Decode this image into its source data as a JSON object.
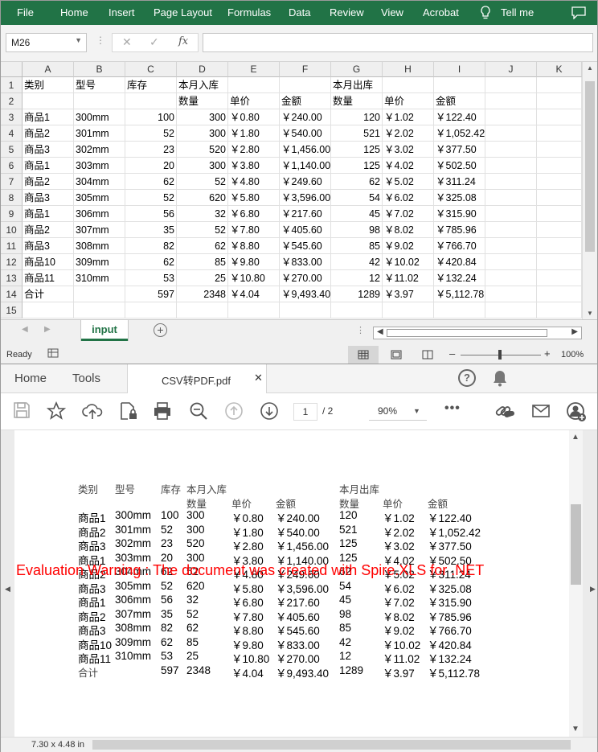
{
  "excel": {
    "ribbon_tabs": [
      "File",
      "Home",
      "Insert",
      "Page Layout",
      "Formulas",
      "Data",
      "Review",
      "View",
      "Acrobat"
    ],
    "tell_me": "Tell me",
    "name_box": "M26",
    "fx_label": "fx",
    "columns": [
      "A",
      "B",
      "C",
      "D",
      "E",
      "F",
      "G",
      "H",
      "I",
      "J",
      "K"
    ],
    "row_numbers": [
      "1",
      "2",
      "3",
      "4",
      "5",
      "6",
      "7",
      "8",
      "9",
      "10",
      "11",
      "12",
      "13",
      "14",
      "15"
    ],
    "rows": [
      [
        "类别",
        "型号",
        "库存",
        "本月入库",
        "",
        "",
        "本月出库",
        "",
        ""
      ],
      [
        "",
        "",
        "",
        "数量",
        "单价",
        "金额",
        "数量",
        "单价",
        "金额"
      ],
      [
        "商品1",
        "300mm",
        "100",
        "300",
        "￥0.80",
        "￥240.00",
        "120",
        "￥1.02",
        "￥122.40"
      ],
      [
        "商品2",
        "301mm",
        "52",
        "300",
        "￥1.80",
        "￥540.00",
        "521",
        "￥2.02",
        "￥1,052.42"
      ],
      [
        "商品3",
        "302mm",
        "23",
        "520",
        "￥2.80",
        "￥1,456.00",
        "125",
        "￥3.02",
        "￥377.50"
      ],
      [
        "商品1",
        "303mm",
        "20",
        "300",
        "￥3.80",
        "￥1,140.00",
        "125",
        "￥4.02",
        "￥502.50"
      ],
      [
        "商品2",
        "304mm",
        "62",
        "52",
        "￥4.80",
        "￥249.60",
        "62",
        "￥5.02",
        "￥311.24"
      ],
      [
        "商品3",
        "305mm",
        "52",
        "620",
        "￥5.80",
        "￥3,596.00",
        "54",
        "￥6.02",
        "￥325.08"
      ],
      [
        "商品1",
        "306mm",
        "56",
        "32",
        "￥6.80",
        "￥217.60",
        "45",
        "￥7.02",
        "￥315.90"
      ],
      [
        "商品2",
        "307mm",
        "35",
        "52",
        "￥7.80",
        "￥405.60",
        "98",
        "￥8.02",
        "￥785.96"
      ],
      [
        "商品3",
        "308mm",
        "82",
        "62",
        "￥8.80",
        "￥545.60",
        "85",
        "￥9.02",
        "￥766.70"
      ],
      [
        "商品10",
        "309mm",
        "62",
        "85",
        "￥9.80",
        "￥833.00",
        "42",
        "￥10.02",
        "￥420.84"
      ],
      [
        "商品11",
        "310mm",
        "53",
        "25",
        "￥10.80",
        "￥270.00",
        "12",
        "￥11.02",
        "￥132.24"
      ],
      [
        "合计",
        "",
        "597",
        "2348",
        "￥4.04",
        "￥9,493.40",
        "1289",
        "￥3.97",
        "￥5,112.78"
      ],
      [
        "",
        "",
        "",
        "",
        "",
        "",
        "",
        "",
        ""
      ]
    ],
    "sheet_tab": "input",
    "status_ready": "Ready",
    "zoom": "100%"
  },
  "pdf": {
    "tabs": [
      "Home",
      "Tools"
    ],
    "doc_tab": "CSV转PDF.pdf",
    "page_current": "1",
    "page_total": "/ 2",
    "zoom": "90%",
    "page_size": "7.30 x 4.48 in",
    "warning": "Evaluation Warning : The document was created with Spire.XLS for .NET"
  },
  "colors": {
    "excel_green": "#217346",
    "warning_red": "#ff0000"
  }
}
